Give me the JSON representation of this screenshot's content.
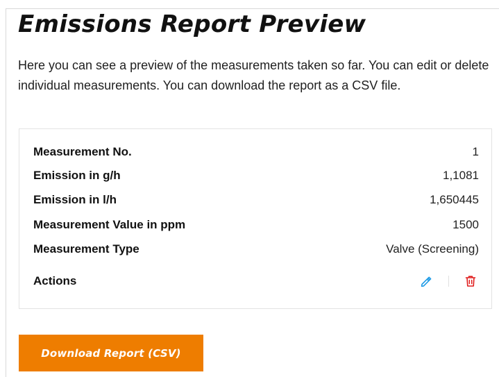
{
  "page": {
    "title": "Emissions Report Preview",
    "intro": "Here you can see a preview of the measurements taken so far. You can edit or delete individual measurements. You can download the report as a CSV file."
  },
  "measurement": {
    "rows": [
      {
        "label": "Measurement No.",
        "value": "1"
      },
      {
        "label": "Emission in g/h",
        "value": "1,1081"
      },
      {
        "label": "Emission in l/h",
        "value": "1,650445"
      },
      {
        "label": "Measurement Value in ppm",
        "value": "1500"
      },
      {
        "label": "Measurement Type",
        "value": "Valve (Screening)"
      }
    ],
    "actions_label": "Actions",
    "edit_icon": "pencil-icon",
    "delete_icon": "trash-icon"
  },
  "download": {
    "label": "Download Report (CSV)"
  },
  "colors": {
    "accent": "#ee7d00",
    "edit": "#1e9be6",
    "delete": "#e01e1e"
  }
}
